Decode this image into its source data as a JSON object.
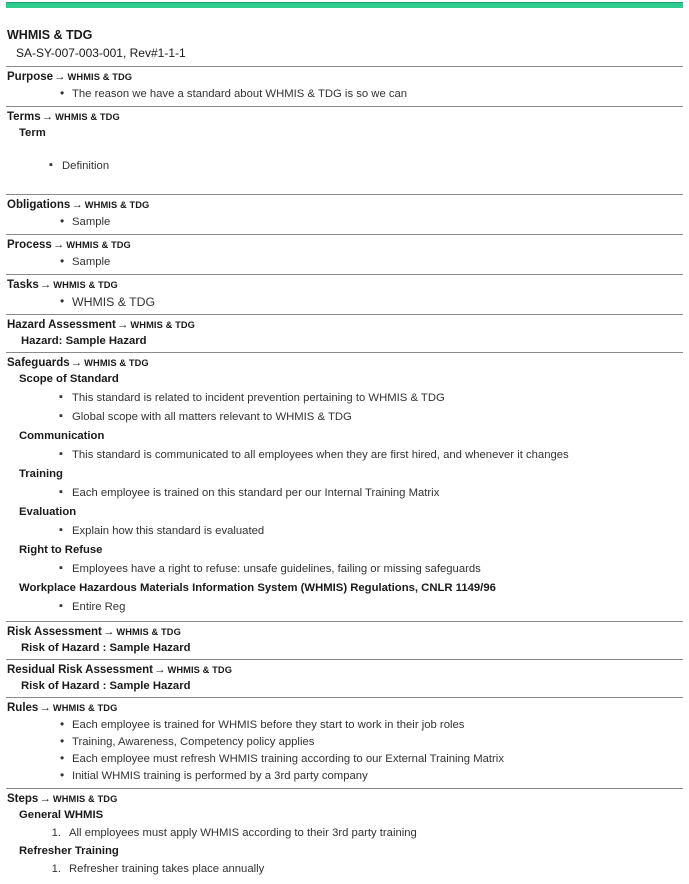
{
  "theme": {
    "accent_color": "#2ecc8f",
    "rule_color": "#8a8a8a",
    "heading_color": "#1a1a1a",
    "body_color": "#333333"
  },
  "document": {
    "title": "WHMIS & TDG",
    "identifier": "SA-SY-007-003-001, Rev#1-1-1",
    "context_label": "WHMIS & TDG",
    "arrow_glyph": "→"
  },
  "sections": {
    "purpose": {
      "label": "Purpose",
      "context": "WHMIS & TDG",
      "items": [
        "The reason we have a standard about WHMIS & TDG is so we can"
      ]
    },
    "terms": {
      "label": "Terms",
      "context": "WHMIS & TDG",
      "term_heading": "Term",
      "items": [
        "Definition"
      ]
    },
    "obligations": {
      "label": "Obligations",
      "context": "WHMIS & TDG",
      "items": [
        "Sample"
      ]
    },
    "process": {
      "label": "Process",
      "context": "WHMIS & TDG",
      "items": [
        "Sample"
      ]
    },
    "tasks": {
      "label": "Tasks",
      "context": "WHMIS & TDG",
      "items": [
        "WHMIS & TDG"
      ]
    },
    "hazard_assessment": {
      "label": "Hazard Assessment",
      "context": "WHMIS & TDG",
      "hazard_line": "Hazard: Sample Hazard"
    },
    "safeguards": {
      "label": "Safeguards",
      "context": "WHMIS & TDG",
      "groups": [
        {
          "heading": "Scope of Standard",
          "items": [
            "This standard is related to incident prevention pertaining to WHMIS & TDG",
            "Global scope with all matters relevant to WHMIS & TDG"
          ]
        },
        {
          "heading": "Communication",
          "items": [
            "This standard is communicated to all employees when they are first hired, and whenever it changes"
          ]
        },
        {
          "heading": "Training",
          "items": [
            "Each employee is trained on this standard per our Internal Training Matrix"
          ]
        },
        {
          "heading": "Evaluation",
          "items": [
            "Explain how this standard is evaluated"
          ]
        },
        {
          "heading": "Right to Refuse",
          "items": [
            "Employees have a right to refuse: unsafe guidelines, failing or missing safeguards"
          ]
        },
        {
          "heading": "Workplace Hazardous Materials Information System (WHMIS) Regulations, CNLR 1149/96",
          "items": [
            "Entire Reg"
          ]
        }
      ]
    },
    "risk_assessment": {
      "label": "Risk Assessment",
      "context": "WHMIS & TDG",
      "risk_line": "Risk of Hazard : Sample Hazard"
    },
    "residual_risk_assessment": {
      "label": "Residual Risk Assessment",
      "context": "WHMIS & TDG",
      "risk_line": "Risk of Hazard : Sample Hazard"
    },
    "rules": {
      "label": "Rules",
      "context": "WHMIS & TDG",
      "items": [
        "Each employee is trained for WHMIS before they start to work in their job roles",
        "Training, Awareness, Competency policy applies",
        "Each employee must refresh WHMIS training according to our External Training Matrix",
        "Initial WHMIS training is performed by a 3rd party company"
      ]
    },
    "steps": {
      "label": "Steps",
      "context": "WHMIS & TDG",
      "groups": [
        {
          "heading": "General WHMIS",
          "items": [
            "All employees must apply WHMIS according to their 3rd party training"
          ]
        },
        {
          "heading": "Refresher Training",
          "items": [
            "Refresher training takes place annually"
          ]
        }
      ]
    }
  }
}
